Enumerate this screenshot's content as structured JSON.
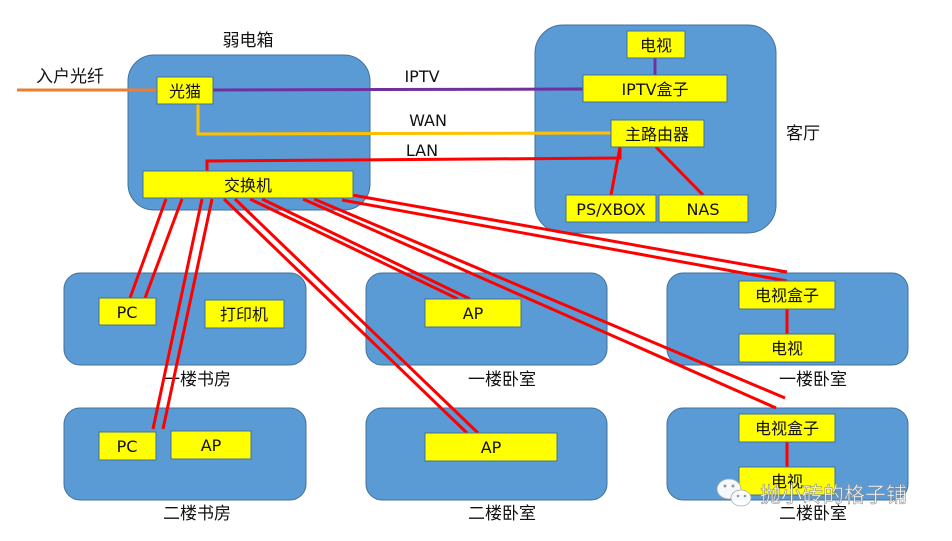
{
  "labels": {
    "cabinet": "弱电箱",
    "fiber": "入户光纤",
    "iptv": "IPTV",
    "wan": "WAN",
    "lan": "LAN",
    "living_room": "客厅"
  },
  "cabinet": {
    "modem": "光猫",
    "switch": "交换机"
  },
  "living": {
    "tv": "电视",
    "iptv_box": "IPTV盒子",
    "router": "主路由器",
    "console": "PS/XBOX",
    "nas": "NAS"
  },
  "rooms": [
    {
      "name": "一楼书房",
      "devices": [
        "PC",
        "打印机"
      ]
    },
    {
      "name": "一楼卧室",
      "devices": [
        "AP"
      ]
    },
    {
      "name": "一楼卧室",
      "devices": [
        "电视盒子",
        "电视"
      ]
    },
    {
      "name": "二楼书房",
      "devices": [
        "PC",
        "AP"
      ]
    },
    {
      "name": "二楼卧室",
      "devices": [
        "AP"
      ]
    },
    {
      "name": "二楼卧室",
      "devices": [
        "电视盒子",
        "电视"
      ]
    }
  ],
  "colors": {
    "fiber": "#ed7d31",
    "iptv": "#7030a0",
    "wan": "#ffc000",
    "lan": "#ff0000",
    "room": "#5b9bd5",
    "device": "#ffff00"
  },
  "watermark": "抛小砖的格子铺"
}
